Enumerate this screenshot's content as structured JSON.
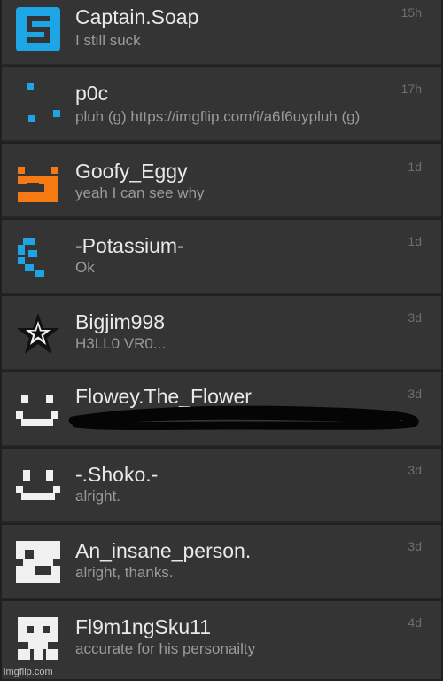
{
  "colors": {
    "background": "#1f1f1f",
    "row_background": "#343434",
    "divider": "#262626",
    "username": "#e9e9e9",
    "preview": "#9a9a9a",
    "timestamp": "#6e6e6e",
    "avatar_blue": "#1ea5e6",
    "avatar_orange": "#f57a14",
    "avatar_white": "#f0f0f0",
    "scribble": "#050505"
  },
  "conversations": [
    {
      "username": "Captain.Soap",
      "preview": "I still suck",
      "time": "15h",
      "avatar": "blue-s-block-icon"
    },
    {
      "username": "p0c",
      "preview": "pluh (g) https://imgflip.com/i/a6f6uypluh (g)",
      "time": "17h",
      "avatar": "blue-dots-icon"
    },
    {
      "username": "Goofy_Eggy",
      "preview": "yeah I can see why",
      "time": "1d",
      "avatar": "orange-pixel-face-icon"
    },
    {
      "username": "-Potassium-",
      "preview": "Ok",
      "time": "1d",
      "avatar": "blue-pixel-shape-icon"
    },
    {
      "username": "Bigjim998",
      "preview": "H3LL0 VR0...",
      "time": "3d",
      "avatar": "star-icon"
    },
    {
      "username": "Flowey.The_Flower",
      "preview": "",
      "time": "3d",
      "avatar": "white-smiley-icon"
    },
    {
      "username": "-.Shoko.-",
      "preview": "alright.",
      "time": "3d",
      "avatar": "white-pixel-smile-icon"
    },
    {
      "username": "An_insane_person.",
      "preview": "alright, thanks.",
      "time": "3d",
      "avatar": "white-pixel-block-icon"
    },
    {
      "username": "Fl9m1ngSku11",
      "preview": "accurate for his personailty",
      "time": "4d",
      "avatar": "white-pixel-totem-icon"
    }
  ],
  "watermark": "imgflip.com"
}
